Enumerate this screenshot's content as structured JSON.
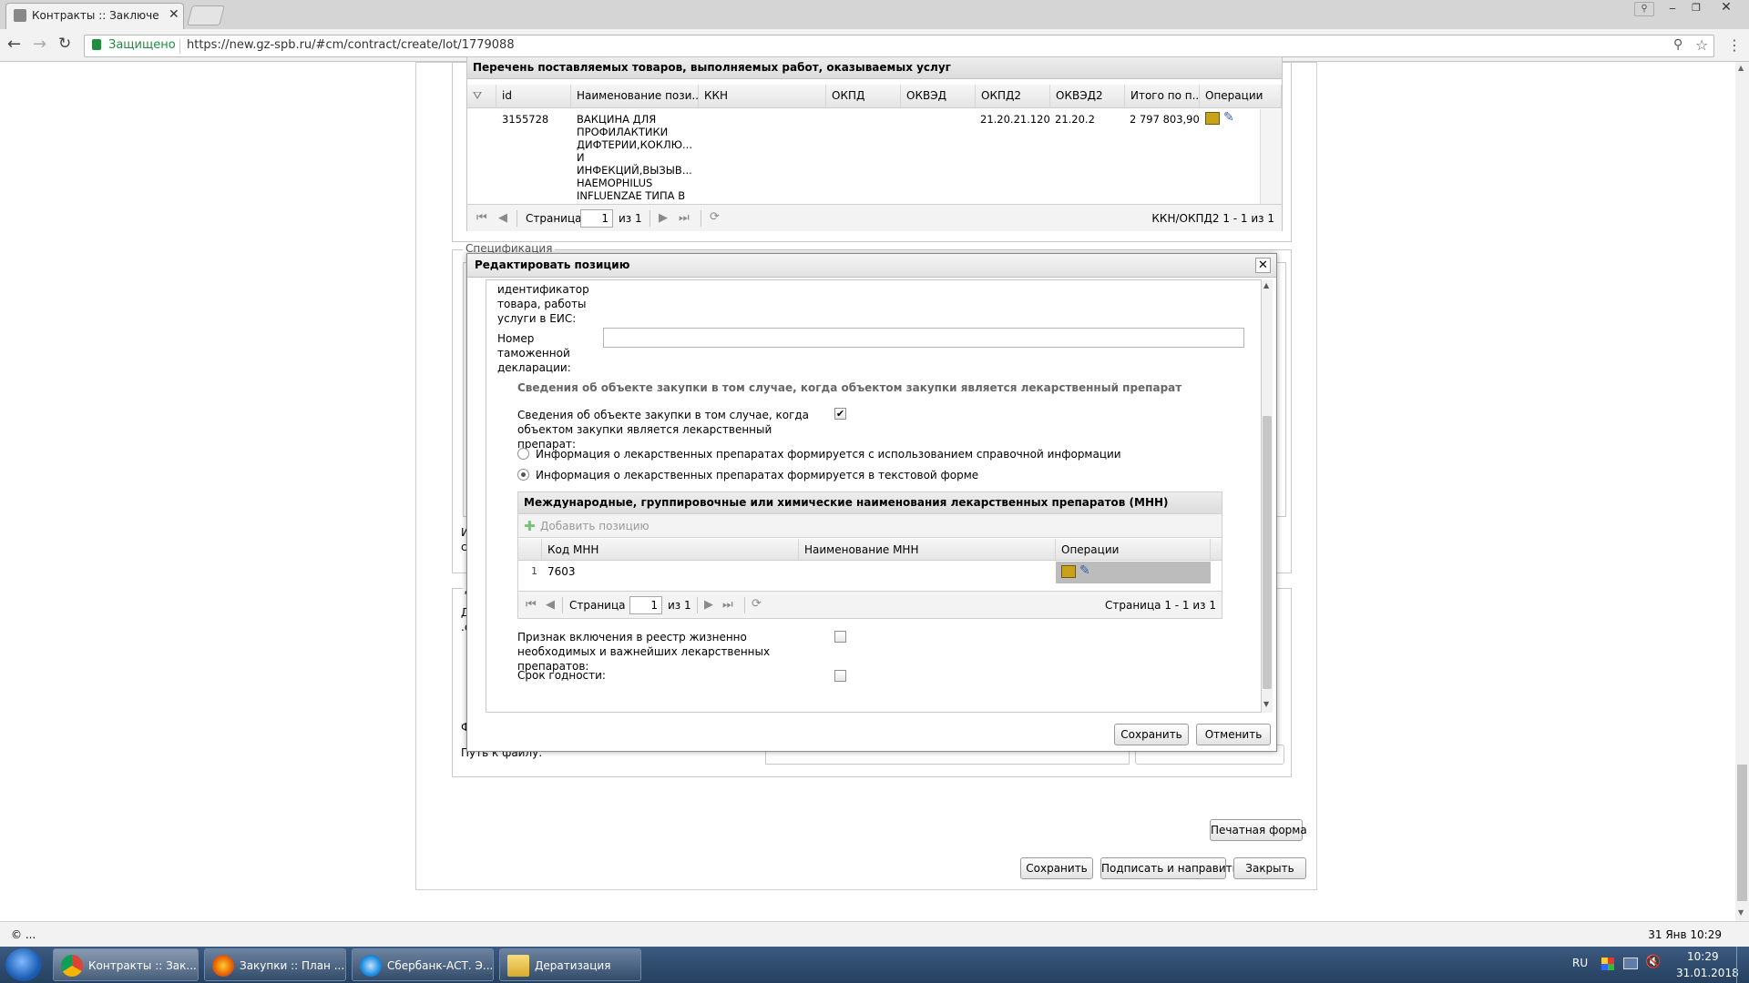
{
  "browser": {
    "tab_title": "Контракты :: Заключени",
    "secure_label": "Защищено",
    "url": "https://new.gz-spb.ru/#cm/contract/create/lot/1779088"
  },
  "goods_section": {
    "title": "Перечень поставляемых товаров, выполняемых работ, оказываемых услуг",
    "columns": [
      "id",
      "Наименование пози...",
      "ККН",
      "ОКПД",
      "ОКВЭД",
      "ОКПД2",
      "ОКВЭД2",
      "Итого по п...",
      "Операции"
    ],
    "row": {
      "id": "3155728",
      "name": "ВАКЦИНА ДЛЯ ПРОФИЛАКТИКИ ДИФТЕРИИ,КОКЛЮ... И ИНФЕКЦИЙ,ВЫЗЫВ... HAEMOPHILUS INFLUENZAE ТИПА B",
      "okpd2": "21.20.21.120",
      "okved2": "21.20.2",
      "total": "2 797 803,90"
    },
    "pager": {
      "page_label": "Страница",
      "page": "1",
      "of": "из 1",
      "summary": "ККН/ОКПД2 1 - 1 из 1"
    }
  },
  "spec_section": {
    "title": "Спецификация"
  },
  "background_fragments": {
    "frag1": "И",
    "frag2": "сг",
    "frag3": "Д",
    "frag4": "Д",
    "frag5": ".с",
    "frag6": "Ф",
    "file_path_label": "Путь к файлу:"
  },
  "page_buttons": {
    "print": "Печатная форма",
    "save": "Сохранить",
    "sign_send": "Подписать и направить",
    "close": "Закрыть"
  },
  "modal": {
    "title": "Редактировать позицию",
    "eis_label": "идентификатор товара, работы услуги в ЕИС:",
    "customs_label": "Номер таможенной декларации:",
    "customs_value": "",
    "drug_section_title": "Сведения об объекте закупки в том случае, когда объектом закупки является лекарственный препарат",
    "drug_checkbox_label": "Сведения об объекте закупки в том случае, когда объектом закупки является лекарственный препарат:",
    "drug_checkbox_checked": true,
    "radio1_label": "Информация о лекарственных препаратах формируется с использованием справочной информации",
    "radio2_label": "Информация о лекарственных препаратах формируется в текстовой форме",
    "mnn_grid": {
      "title": "Международные, группировочные или химические наименования лекарственных препаратов (МНН)",
      "add_label": "Добавить позицию",
      "columns": [
        "Код МНН",
        "Наименование МНН",
        "Операции"
      ],
      "rows": [
        {
          "n": "1",
          "code": "7603",
          "name": ""
        }
      ],
      "pager": {
        "page_label": "Страница",
        "page": "1",
        "of": "из 1",
        "summary": "Страница 1 - 1 из 1"
      }
    },
    "registry_label": "Признак включения в реестр жизненно необходимых и важнейших лекарственных препаратов:",
    "expiry_label": "Срок годности:",
    "save": "Сохранить",
    "cancel": "Отменить"
  },
  "status": {
    "left": "© ...",
    "right": "31 Янв 10:29"
  },
  "taskbar": {
    "items": [
      "Контракты :: Зак...",
      "Закупки :: План ...",
      "Сбербанк-АСТ. Э...",
      "Дератизация"
    ],
    "lang": "RU",
    "time": "10:29",
    "date": "31.01.2018"
  },
  "colors": {
    "taskbar": "#25405f",
    "accent_green": "#1e8e3e",
    "link": "#1a55b2"
  }
}
